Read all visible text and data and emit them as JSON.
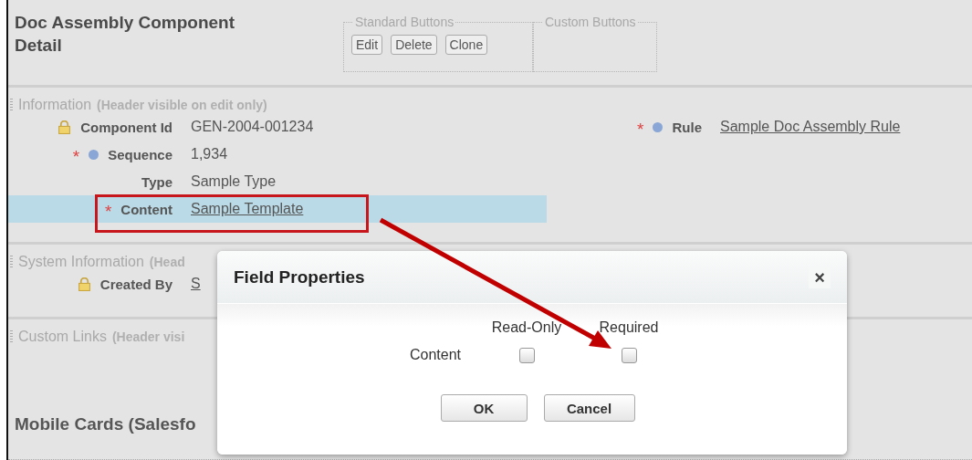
{
  "header": {
    "title": "Doc Assembly Component Detail",
    "standard_buttons": {
      "legend": "Standard Buttons",
      "buttons": [
        "Edit",
        "Delete",
        "Clone"
      ]
    },
    "custom_buttons": {
      "legend": "Custom Buttons"
    }
  },
  "information": {
    "title": "Information",
    "note": "(Header visible on edit only)",
    "left_fields": [
      {
        "kind": "locked",
        "label": "Component Id",
        "value": "GEN-2004-001234",
        "link": false,
        "highlighted": false
      },
      {
        "kind": "dot",
        "required_mark": "*",
        "label": "Sequence",
        "value": "1,934",
        "link": false,
        "highlighted": false
      },
      {
        "kind": "plain",
        "label": "Type",
        "value": "Sample Type",
        "link": false,
        "highlighted": false
      },
      {
        "kind": "plain",
        "required_mark": "*",
        "label": "Content",
        "value": "Sample Template",
        "link": true,
        "highlighted": true
      }
    ],
    "right_fields": [
      {
        "kind": "dot",
        "required_mark": "*",
        "label": "Rule",
        "value": "Sample Doc Assembly Rule",
        "link": true
      }
    ]
  },
  "system_information": {
    "title": "System Information",
    "note": "(Head",
    "fields": [
      {
        "kind": "locked",
        "label": "Created By",
        "value": "S",
        "link": true
      }
    ]
  },
  "custom_links": {
    "title": "Custom Links",
    "note": "(Header visi"
  },
  "mobile_cards": {
    "title": "Mobile Cards (Salesfo"
  },
  "dialog": {
    "title": "Field Properties",
    "close": "×",
    "columns": [
      "Read-Only",
      "Required"
    ],
    "rows": [
      {
        "label": "Content",
        "read_only": false,
        "required": false
      }
    ],
    "buttons": [
      "OK",
      "Cancel"
    ]
  }
}
